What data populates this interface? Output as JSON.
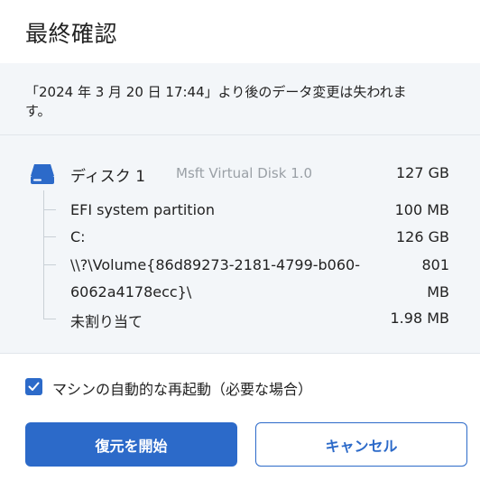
{
  "dialog": {
    "title": "最終確認",
    "warning_line1": "「2024 年 3 月 20 日 17:44」より後のデータ変更は失われま",
    "warning_line2": "す。"
  },
  "disk": {
    "icon": "hard-drive-icon",
    "name": "ディスク 1",
    "model": "Msft Virtual Disk 1.0",
    "size": "127 GB",
    "partitions": [
      {
        "name": "EFI system partition",
        "size": "100 MB"
      },
      {
        "name": "C:",
        "size": "126 GB"
      },
      {
        "name_line1": "\\\\?\\Volume{86d89273-2181-4799-b060-",
        "name_line2": "6062a4178ecc}\\",
        "size_line1": "801",
        "size_line2": "MB"
      },
      {
        "name": "未割り当て",
        "size": "1.98 MB"
      }
    ]
  },
  "options": {
    "auto_restart_checked": true,
    "auto_restart_label": "マシンの自動的な再起動（必要な場合）"
  },
  "buttons": {
    "start_restore": "復元を開始",
    "cancel": "キャンセル"
  },
  "colors": {
    "accent": "#2c6ac9",
    "panel_bg": "#f3f6f9",
    "muted_text": "#9aa0a6"
  }
}
